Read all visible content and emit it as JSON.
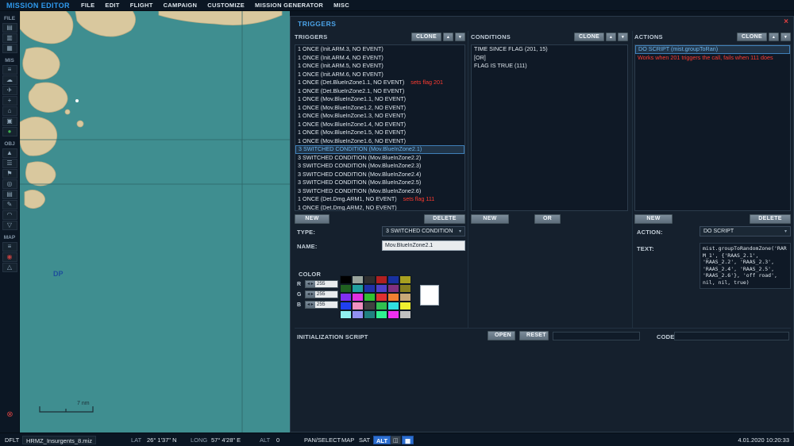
{
  "icons": {
    "close": "×",
    "up": "▴",
    "down": "▾",
    "dropdown": "▾",
    "stepper": "◂ ▸"
  },
  "app": {
    "title": "MISSION EDITOR",
    "menu": [
      "FILE",
      "EDIT",
      "FLIGHT",
      "CAMPAIGN",
      "CUSTOMIZE",
      "MISSION GENERATOR",
      "MISC"
    ]
  },
  "sidebar": {
    "sections": [
      {
        "label": "FILE",
        "icons": [
          {
            "name": "new-mission-icon",
            "glyph": "▤"
          },
          {
            "name": "open-mission-icon",
            "glyph": "▥"
          },
          {
            "name": "save-mission-icon",
            "glyph": "▦"
          }
        ]
      },
      {
        "label": "MIS",
        "icons": [
          {
            "name": "briefing-icon",
            "glyph": "≡"
          },
          {
            "name": "weather-icon",
            "glyph": "☁"
          },
          {
            "name": "aircraft-group-icon",
            "glyph": "✈"
          },
          {
            "name": "helicopter-group-icon",
            "glyph": "+"
          },
          {
            "name": "ship-group-icon",
            "glyph": "⌂"
          },
          {
            "name": "vehicle-group-icon",
            "glyph": "▣"
          },
          {
            "name": "trigger-zone-icon",
            "glyph": "●",
            "color": "#3fae4e"
          }
        ]
      },
      {
        "label": "OBJ",
        "icons": [
          {
            "name": "static-object-icon",
            "glyph": "▲"
          },
          {
            "name": "unit-list-icon",
            "glyph": "☰"
          },
          {
            "name": "triggers-icon",
            "glyph": "⚑"
          },
          {
            "name": "goals-icon",
            "glyph": "◎"
          },
          {
            "name": "summary-icon",
            "glyph": "▤"
          },
          {
            "name": "draw-tool-icon",
            "glyph": "✎"
          },
          {
            "name": "distance-tool-icon",
            "glyph": "◠"
          },
          {
            "name": "marker-icon",
            "glyph": "▽"
          }
        ]
      },
      {
        "label": "MAP",
        "icons": [
          {
            "name": "layers-icon",
            "glyph": "≡"
          },
          {
            "name": "map-marker-icon",
            "glyph": "◉",
            "color": "#c04040"
          },
          {
            "name": "ruler-icon",
            "glyph": "△"
          }
        ]
      }
    ],
    "exit": {
      "name": "exit-icon",
      "glyph": "⊗",
      "color": "#d04040"
    }
  },
  "map": {
    "dp_label": "DP",
    "scale_label": "7 nm"
  },
  "panel": {
    "title": "TRIGGERS",
    "triggers": {
      "header": "TRIGGERS",
      "clone_label": "CLONE",
      "new_label": "NEW",
      "delete_label": "DELETE",
      "items": [
        {
          "text": "1 ONCE (Init.ARM.3, NO EVENT)"
        },
        {
          "text": "1 ONCE (Init.ARM.4, NO EVENT)"
        },
        {
          "text": "1 ONCE (Init.ARM.5, NO EVENT)"
        },
        {
          "text": "1 ONCE (Init.ARM.6, NO EVENT)"
        },
        {
          "text": "1 ONCE (Det.BlueInZone1.1, NO EVENT)",
          "note": "sets flag 201"
        },
        {
          "text": "1 ONCE (Det.BlueInZone2.1, NO EVENT)"
        },
        {
          "text": "1 ONCE (Mov.BlueInZone1.1, NO EVENT)"
        },
        {
          "text": "1 ONCE (Mov.BlueInZone1.2, NO EVENT)"
        },
        {
          "text": "1 ONCE (Mov.BlueInZone1.3, NO EVENT)"
        },
        {
          "text": "1 ONCE (Mov.BlueInZone1.4, NO EVENT)"
        },
        {
          "text": "1 ONCE (Mov.BlueInZone1.5, NO EVENT)"
        },
        {
          "text": "1 ONCE (Mov.BlueInZone1.6, NO EVENT)"
        },
        {
          "text": "3 SWITCHED CONDITION (Mov.BlueInZone2.1)",
          "selected": true
        },
        {
          "text": "3 SWITCHED CONDITION (Mov.BlueInZone2.2)"
        },
        {
          "text": "3 SWITCHED CONDITION (Mov.BlueInZone2.3)"
        },
        {
          "text": "3 SWITCHED CONDITION (Mov.BlueInZone2.4)"
        },
        {
          "text": "3 SWITCHED CONDITION (Mov.BlueInZone2.5)"
        },
        {
          "text": "3 SWITCHED CONDITION (Mov.BlueInZone2.6)"
        },
        {
          "text": "1 ONCE (Det.Dmg.ARM1, NO EVENT)",
          "note": "sets flag 111"
        },
        {
          "text": "1 ONCE (Det.Dmg.ARM2, NO EVENT)"
        }
      ]
    },
    "conditions": {
      "header": "CONDITIONS",
      "clone_label": "CLONE",
      "new_label": "NEW",
      "or_label": "OR",
      "items": [
        {
          "text": "TIME SINCE FLAG (201, 15)"
        },
        {
          "text": "[OR]"
        },
        {
          "text": "FLAG IS TRUE (111)"
        }
      ]
    },
    "actions": {
      "header": "ACTIONS",
      "clone_label": "CLONE",
      "new_label": "NEW",
      "delete_label": "DELETE",
      "items": [
        {
          "text": "DO SCRIPT (mist.groupToRan)",
          "selected": true
        },
        {
          "text": "Works when 201 triggers the call, fails when 111 does",
          "warning": true
        }
      ]
    },
    "type": {
      "label": "TYPE:",
      "value": "3 SWITCHED CONDITION"
    },
    "name": {
      "label": "NAME:",
      "value": "Mov.BlueInZone2.1"
    },
    "color": {
      "label": "COLOR",
      "r_label": "R",
      "g_label": "G",
      "b_label": "B",
      "r": "255",
      "g": "255",
      "b": "255",
      "preview": "#ffffff",
      "palette": [
        [
          "#000000",
          "#9aa49c",
          "#2e2e2e",
          "#b02020",
          "#1830a0",
          "#a8a020"
        ],
        [
          "#206020",
          "#20a0a0",
          "#2030a8",
          "#5040c8",
          "#803080",
          "#888020"
        ],
        [
          "#8030f0",
          "#e030e0",
          "#30c030",
          "#e03030",
          "#f08030",
          "#c8a878"
        ],
        [
          "#2040f0",
          "#f090c0",
          "#404040",
          "#30c050",
          "#30e0e0",
          "#f0f030"
        ],
        [
          "#90f0f0",
          "#9090f0",
          "#208080",
          "#30f090",
          "#f030f0",
          "#c0c0c0"
        ]
      ]
    },
    "action": {
      "label": "ACTION:",
      "value": "DO SCRIPT"
    },
    "text": {
      "label": "TEXT:",
      "value": "mist.groupToRandomZone('RARM_1', {'RAAS_2.1', 'RAAS_2.2', 'RAAS_2.3', 'RAAS_2.4', 'RAAS_2.5', 'RAAS_2.6'}, 'off road', nil, nil, true)"
    },
    "init_script": {
      "label": "INITIALIZATION SCRIPT",
      "open_label": "OPEN",
      "reset_label": "RESET",
      "code_label": "CODE",
      "script_value": "",
      "code_value": ""
    }
  },
  "statusbar": {
    "preset": "DFLT",
    "filename": "HRMZ_Insurgents_8.miz",
    "lat_label": "LAT",
    "lat_value": "26° 1'37\" N",
    "long_label": "LONG",
    "long_value": "57° 4'28\" E",
    "alt_label": "ALT",
    "alt_value": "0",
    "mode": "PAN/SELECT",
    "map_label": "MAP",
    "sat_label": "SAT",
    "alt_btn_label": "ALT",
    "icon1": {
      "name": "snap-grid-icon",
      "glyph": "◫"
    },
    "icon2": {
      "name": "coord-units-icon",
      "glyph": "▦"
    },
    "datetime": "4.01.2020 10:20:33"
  },
  "colors": {
    "accent_blue": "#4ba3e8",
    "warning_red": "#ff3b30",
    "selection_blue": "#3f7fb8",
    "water_teal": "#3f8e90",
    "land_tan": "#d9c89e"
  }
}
